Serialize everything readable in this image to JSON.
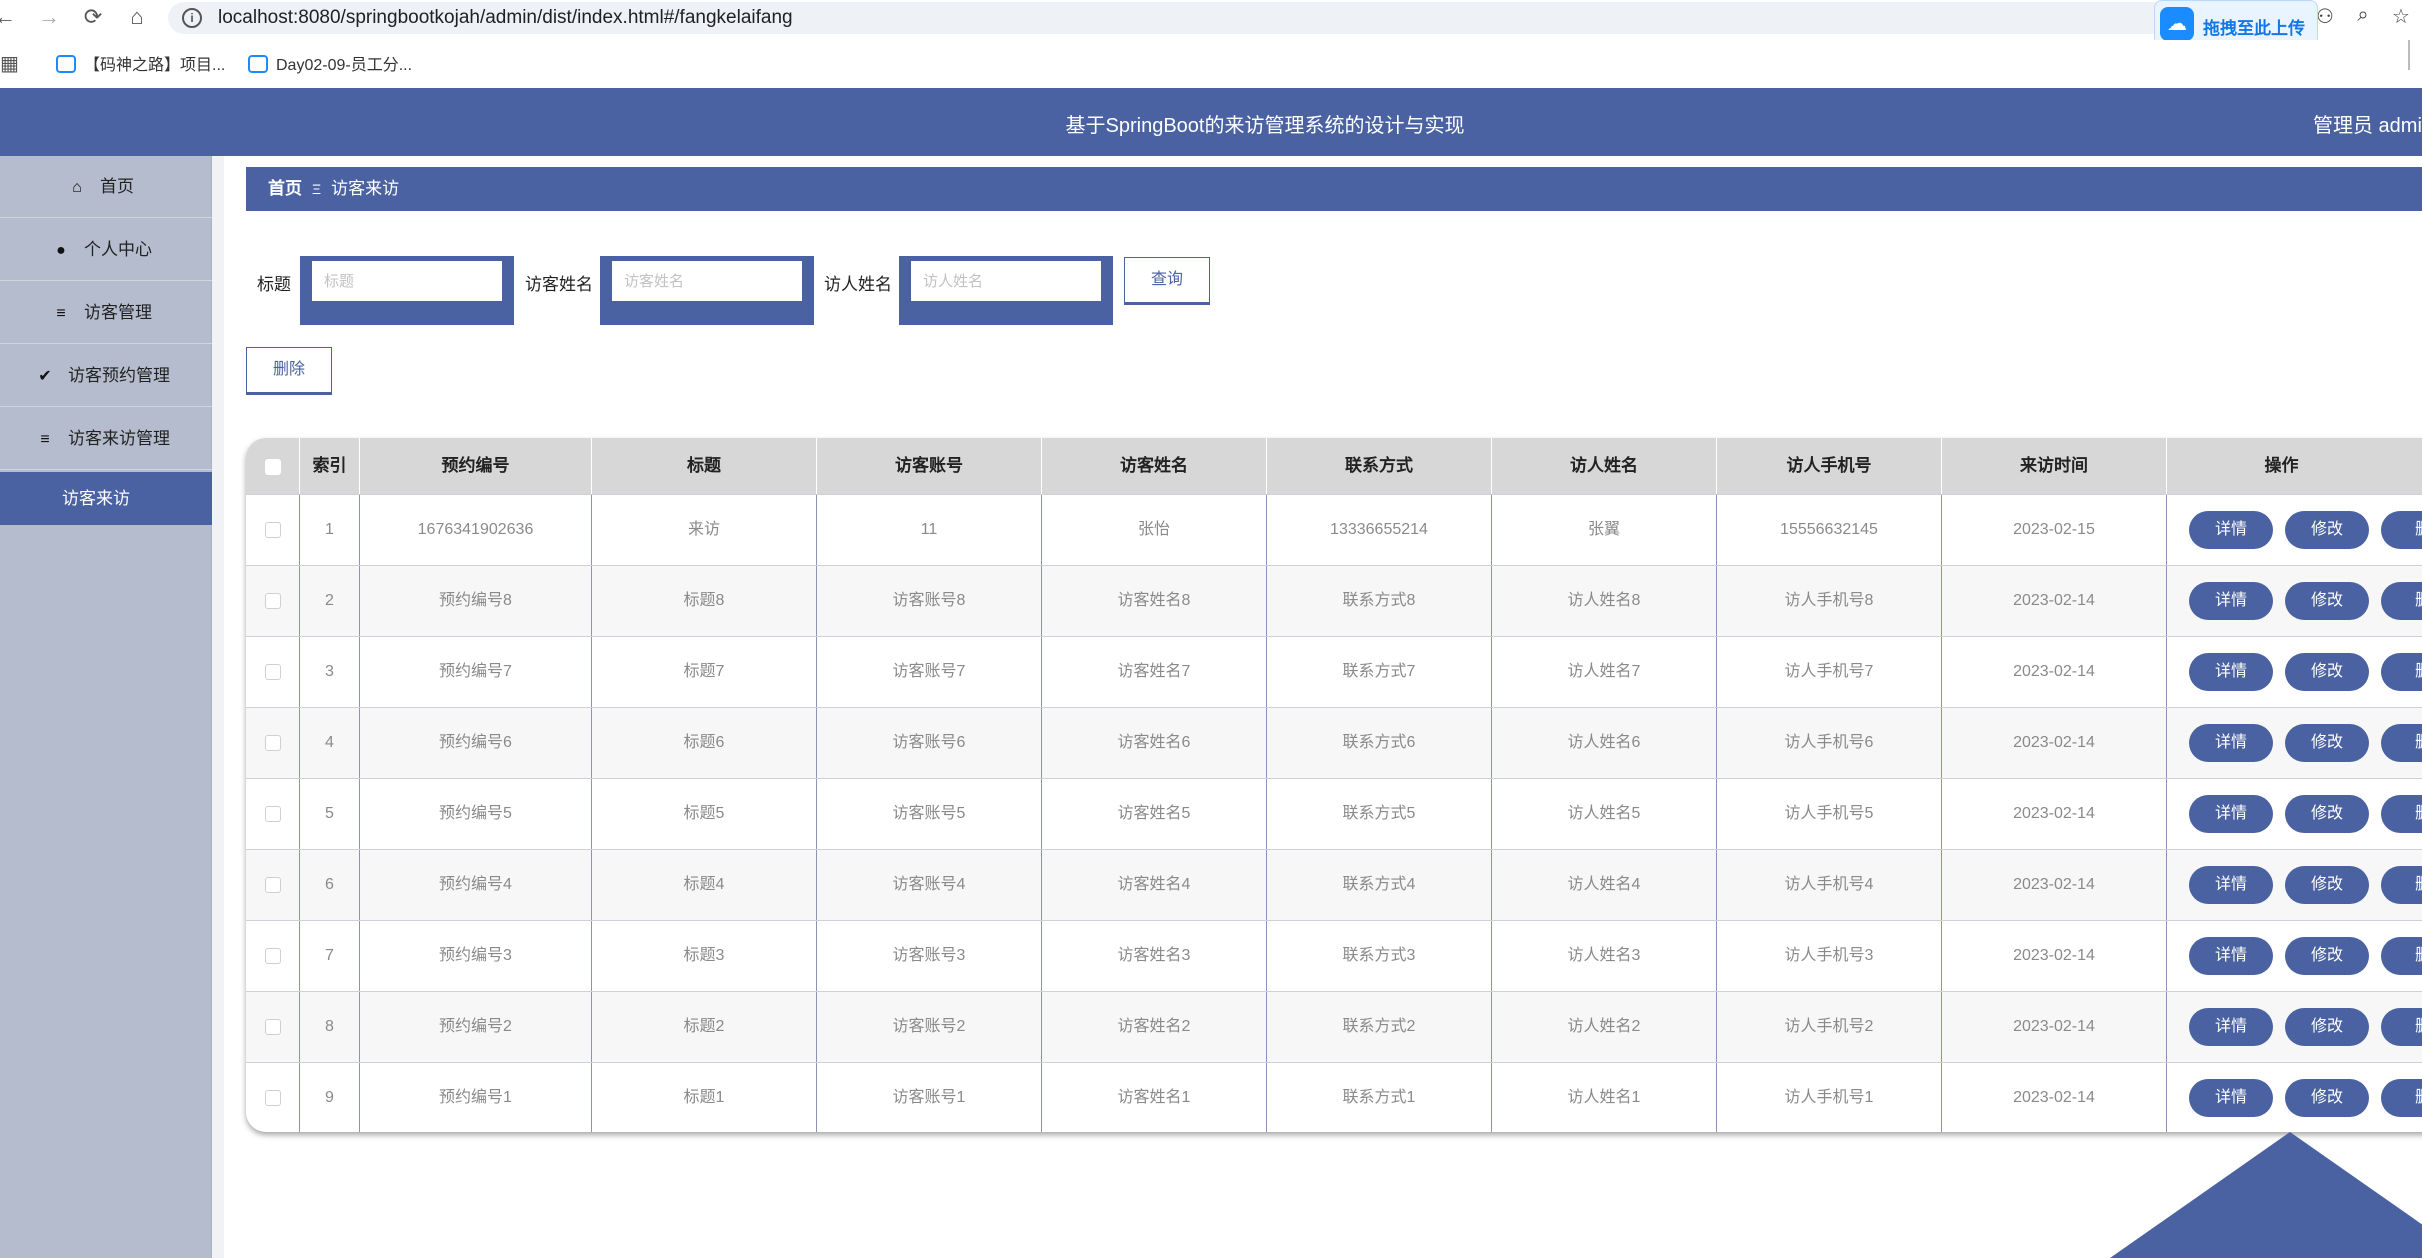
{
  "browser": {
    "back": "←",
    "forward": "→",
    "reload": "⟳",
    "home": "⌂",
    "url": "localhost:8080/springbootkojah/admin/dist/index.html#/fangkelaifang",
    "upload_label": "拖拽至此上传",
    "bookmarks": [
      "【码神之路】项目...",
      "Day02-09-员工分..."
    ]
  },
  "header": {
    "title": "基于SpringBoot的来访管理系统的设计与实现",
    "user": "管理员 admin"
  },
  "sidebar": {
    "items": [
      {
        "label": "首页",
        "icon": "home-icon",
        "glyph": "⌂"
      },
      {
        "label": "个人中心",
        "icon": "user-icon",
        "glyph": "●"
      },
      {
        "label": "访客管理",
        "icon": "list-icon",
        "glyph": "≡"
      },
      {
        "label": "访客预约管理",
        "icon": "clipboard-icon",
        "glyph": "✔"
      },
      {
        "label": "访客来访管理",
        "icon": "list-icon",
        "glyph": "≡"
      }
    ],
    "active_sub": "访客来访"
  },
  "breadcrumb": {
    "home": "首页",
    "separator": "Ξ",
    "current": "访客来访"
  },
  "search": {
    "title_label": "标题",
    "title_placeholder": "标题",
    "visitor_label": "访客姓名",
    "visitor_placeholder": "访客姓名",
    "host_label": "访人姓名",
    "host_placeholder": "访人姓名",
    "query_button": "查询",
    "delete_button": "删除"
  },
  "table": {
    "headers": [
      "索引",
      "预约编号",
      "标题",
      "访客账号",
      "访客姓名",
      "联系方式",
      "访人姓名",
      "访人手机号",
      "来访时间",
      "操作"
    ],
    "actions": {
      "detail": "详情",
      "edit": "修改",
      "delete": "删"
    },
    "rows": [
      {
        "index": "1",
        "booking_no": "1676341902636",
        "title": "来访",
        "account": "11",
        "visitor": "张怡",
        "contact": "13336655214",
        "host": "张翼",
        "host_phone": "15556632145",
        "time": "2023-02-15"
      },
      {
        "index": "2",
        "booking_no": "预约编号8",
        "title": "标题8",
        "account": "访客账号8",
        "visitor": "访客姓名8",
        "contact": "联系方式8",
        "host": "访人姓名8",
        "host_phone": "访人手机号8",
        "time": "2023-02-14"
      },
      {
        "index": "3",
        "booking_no": "预约编号7",
        "title": "标题7",
        "account": "访客账号7",
        "visitor": "访客姓名7",
        "contact": "联系方式7",
        "host": "访人姓名7",
        "host_phone": "访人手机号7",
        "time": "2023-02-14"
      },
      {
        "index": "4",
        "booking_no": "预约编号6",
        "title": "标题6",
        "account": "访客账号6",
        "visitor": "访客姓名6",
        "contact": "联系方式6",
        "host": "访人姓名6",
        "host_phone": "访人手机号6",
        "time": "2023-02-14"
      },
      {
        "index": "5",
        "booking_no": "预约编号5",
        "title": "标题5",
        "account": "访客账号5",
        "visitor": "访客姓名5",
        "contact": "联系方式5",
        "host": "访人姓名5",
        "host_phone": "访人手机号5",
        "time": "2023-02-14"
      },
      {
        "index": "6",
        "booking_no": "预约编号4",
        "title": "标题4",
        "account": "访客账号4",
        "visitor": "访客姓名4",
        "contact": "联系方式4",
        "host": "访人姓名4",
        "host_phone": "访人手机号4",
        "time": "2023-02-14"
      },
      {
        "index": "7",
        "booking_no": "预约编号3",
        "title": "标题3",
        "account": "访客账号3",
        "visitor": "访客姓名3",
        "contact": "联系方式3",
        "host": "访人姓名3",
        "host_phone": "访人手机号3",
        "time": "2023-02-14"
      },
      {
        "index": "8",
        "booking_no": "预约编号2",
        "title": "标题2",
        "account": "访客账号2",
        "visitor": "访客姓名2",
        "contact": "联系方式2",
        "host": "访人姓名2",
        "host_phone": "访人手机号2",
        "time": "2023-02-14"
      },
      {
        "index": "9",
        "booking_no": "预约编号1",
        "title": "标题1",
        "account": "访客账号1",
        "visitor": "访客姓名1",
        "contact": "联系方式1",
        "host": "访人姓名1",
        "host_phone": "访人手机号1",
        "time": "2023-02-14"
      }
    ]
  },
  "colors": {
    "primary": "#4a62a1",
    "sidebar": "#b4bccd",
    "header_row": "#d7d7d7"
  }
}
